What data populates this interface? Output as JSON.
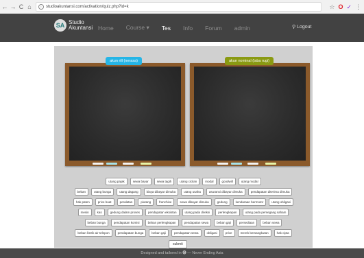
{
  "browser": {
    "url": "studioakuntansi.com/activation/quiz.php?id=k",
    "back_glyph": "←",
    "forward_glyph": "→",
    "reload_glyph": "C",
    "home_glyph": "⌂",
    "info_glyph": "i",
    "star_glyph": "☆",
    "opera_glyph": "O",
    "ext_glyph": "✓",
    "menu_glyph": "⋮"
  },
  "site": {
    "logo_initials": "SA",
    "logo_line1": "Studio",
    "logo_line2": "Akuntansi",
    "menu": [
      "Home",
      "Course ▾",
      "Tes",
      "Info",
      "Forum",
      "admin"
    ],
    "active_menu": "Tes",
    "logout_label": "Logout",
    "logout_icon": "⚲"
  },
  "quiz": {
    "board_left_label": "akun rill (nerasa)",
    "board_right_label": "akun nominal (laba rugi)",
    "chip_rows": [
      [
        "utang pajak",
        "sewa bayar",
        "sewa tagih",
        "utang cicilan",
        "modal",
        "goodwill",
        "utang modal"
      ],
      [
        "beban",
        "utang bunga",
        "utang dagang",
        "biaya dibayar dimuka",
        "utang usaha",
        "asuransi dibayar dimuka",
        "pendapatan diterima dimuka"
      ],
      [
        "hak paten",
        "prive buat",
        "peralatan",
        "piutang",
        "franchise",
        "sewa dibayar dimuka",
        "gedung",
        "kendaraan bermotor",
        "utang obligasi"
      ],
      [
        "mesin",
        "kas",
        "gedung dalam proses",
        "pendapatan eksistan",
        "utang pada direksi",
        "perlengkapan",
        "utang pada pemegang saham"
      ],
      [
        "beban bunga",
        "pendapatan komisi",
        "beban perlengkapan",
        "pendapatan sewa",
        "beban gaji",
        "persediaan",
        "beban sewa"
      ],
      [
        "beban listrik air telepon",
        "pendapatan bunga",
        "beban gaji",
        "pendapatan sewa",
        "obligasi",
        "prive",
        "merek bersangkutan",
        "hak cipta"
      ]
    ],
    "submit_label": "submit"
  },
  "footer": {
    "text": "Designed and tailored in 🅒 — Never Ending Asia"
  },
  "colors": {
    "left_label": "#25b5e6",
    "right_label": "#8a9a12",
    "board_frame": "#8b5a2b",
    "nav_bg": "#424242"
  }
}
